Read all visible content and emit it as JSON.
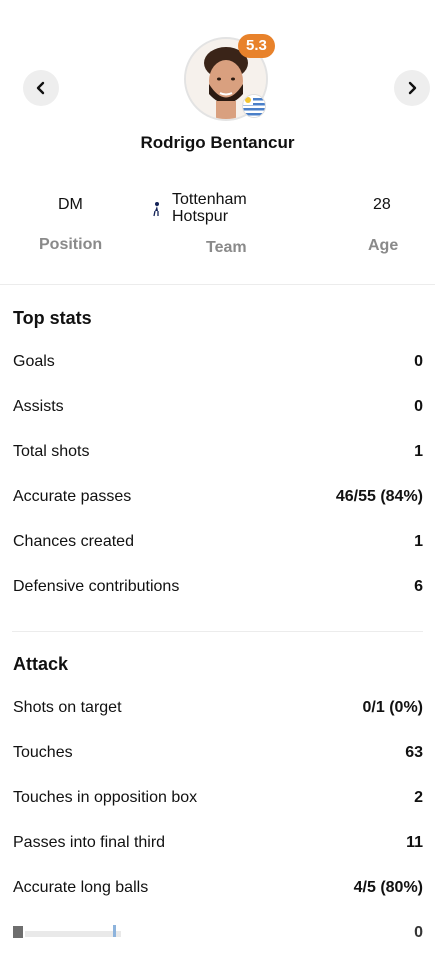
{
  "player": {
    "name": "Rodrigo Bentancur",
    "rating": "5.3",
    "rating_color": "#e8822b",
    "flag": "uruguay-flag-icon"
  },
  "info": {
    "position": {
      "value": "DM",
      "label": "Position"
    },
    "team": {
      "value_line1": "Tottenham",
      "value_line2": "Hotspur",
      "label": "Team"
    },
    "age": {
      "value": "28",
      "label": "Age"
    }
  },
  "top_stats": {
    "title": "Top stats",
    "rows": [
      {
        "label": "Goals",
        "value": "0"
      },
      {
        "label": "Assists",
        "value": "0"
      },
      {
        "label": "Total shots",
        "value": "1"
      },
      {
        "label": "Accurate passes",
        "value": "46/55 (84%)"
      },
      {
        "label": "Chances created",
        "value": "1"
      },
      {
        "label": "Defensive contributions",
        "value": "6"
      }
    ]
  },
  "attack": {
    "title": "Attack",
    "rows": [
      {
        "label": "Shots on target",
        "value": "0/1 (0%)"
      },
      {
        "label": "Touches",
        "value": "63"
      },
      {
        "label": "Touches in opposition box",
        "value": "2"
      },
      {
        "label": "Passes into final third",
        "value": "11"
      },
      {
        "label": "Accurate long balls",
        "value": "4/5 (80%)"
      },
      {
        "label": "",
        "value": "0"
      }
    ]
  }
}
